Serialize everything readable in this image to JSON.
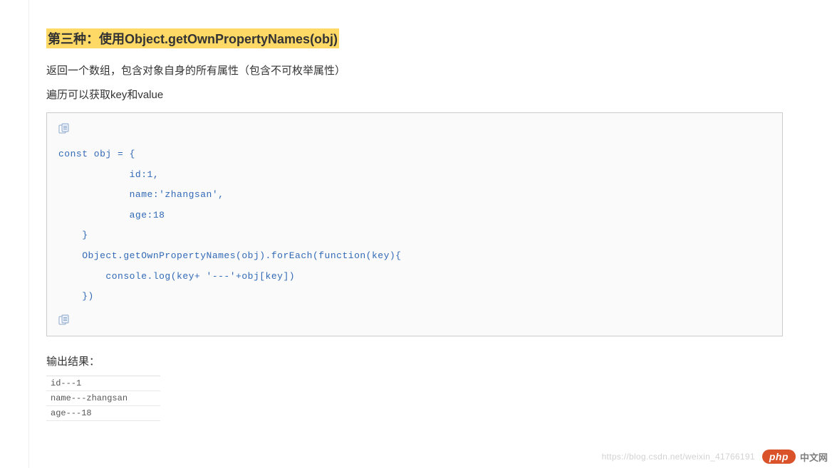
{
  "heading": "第三种：使用Object.getOwnPropertyNames(obj)",
  "para1": "返回一个数组，包含对象自身的所有属性（包含不可枚举属性）",
  "para2": "遍历可以获取key和value",
  "code": "const obj = {\n            id:1,\n            name:'zhangsan',\n            age:18\n    }\n    Object.getOwnPropertyNames(obj).forEach(function(key){\n        console.log(key+ '---'+obj[key])\n    })",
  "output_title": "输出结果：",
  "console_rows": [
    "id---1",
    "name---zhangsan",
    "age---18"
  ],
  "watermark_url": "https://blog.csdn.net/weixin_41766191",
  "watermark_badge": "php",
  "watermark_cn": "中文网"
}
